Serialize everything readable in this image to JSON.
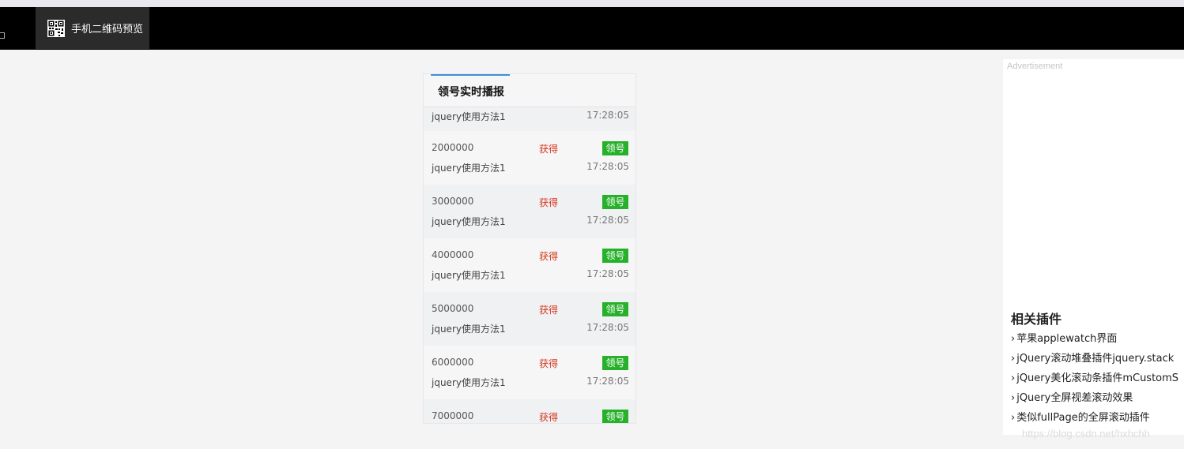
{
  "toolbar": {
    "qr_label": "手机二维码预览",
    "qr_icon": "qr-code-icon"
  },
  "panel": {
    "title": "领号实时播报",
    "first_row": {
      "name": "jquery使用方法1",
      "time": "17:28:05"
    },
    "rows": [
      {
        "num": "2000000",
        "get": "获得",
        "badge": "领号",
        "name": "jquery使用方法1",
        "time": "17:28:05"
      },
      {
        "num": "3000000",
        "get": "获得",
        "badge": "领号",
        "name": "jquery使用方法1",
        "time": "17:28:05"
      },
      {
        "num": "4000000",
        "get": "获得",
        "badge": "领号",
        "name": "jquery使用方法1",
        "time": "17:28:05"
      },
      {
        "num": "5000000",
        "get": "获得",
        "badge": "领号",
        "name": "jquery使用方法1",
        "time": "17:28:05"
      },
      {
        "num": "6000000",
        "get": "获得",
        "badge": "领号",
        "name": "jquery使用方法1",
        "time": "17:28:05"
      },
      {
        "num": "7000000",
        "get": "获得",
        "badge": "领号",
        "name": "",
        "time": ""
      }
    ]
  },
  "sidebar": {
    "ad_label": "Advertisement",
    "related_title": "相关插件",
    "related": [
      "苹果applewatch界面",
      "jQuery滚动堆叠插件jquery.stack",
      "jQuery美化滚动条插件mCustomS",
      "jQuery全屏视差滚动效果",
      "类似fullPage的全屏滚动插件"
    ]
  },
  "watermark": "https://blog.csdn.net/hxhchh",
  "colors": {
    "accent_blue": "#3f8fdc",
    "badge_green": "#27b12a",
    "get_red": "#d6341c",
    "topbar": "#000000"
  }
}
